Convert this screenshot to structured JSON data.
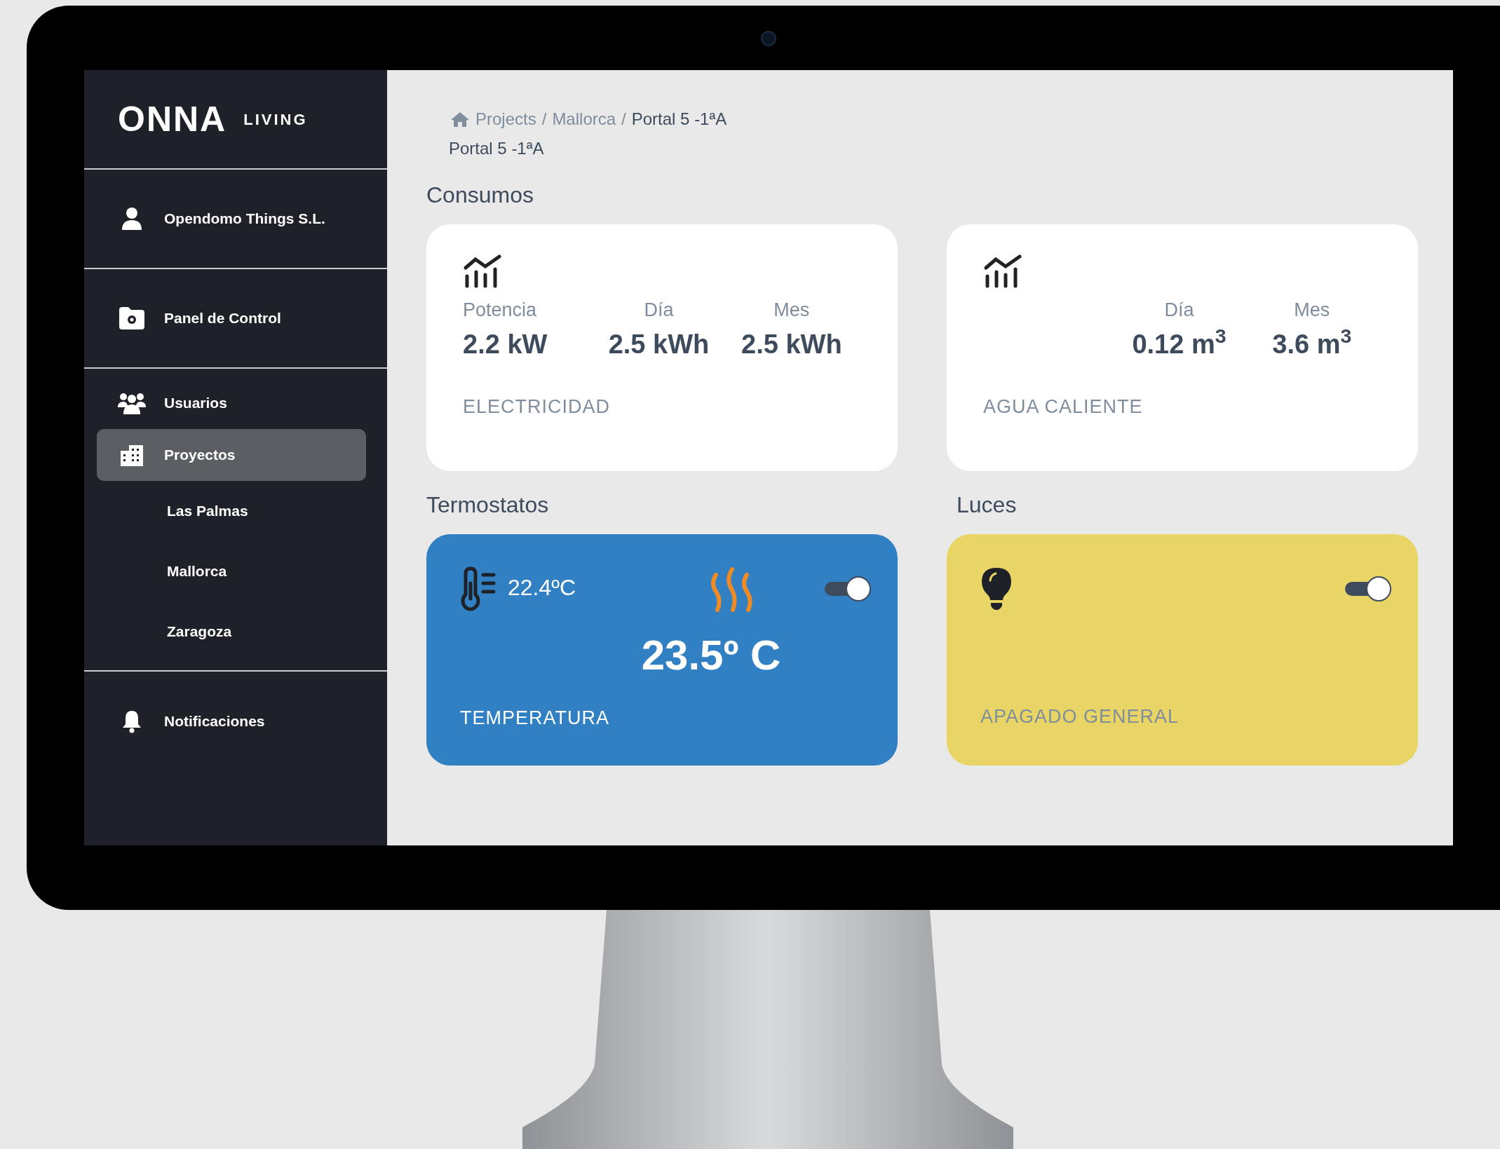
{
  "sidebar": {
    "logo": {
      "brand": "ONNA",
      "tagline": "LIVING"
    },
    "groups": [
      {
        "items": [
          {
            "kind": "nav",
            "label": "Opendomo Things S.L.",
            "selected": false
          }
        ]
      },
      {
        "items": [
          {
            "kind": "nav",
            "label": "Panel de Control",
            "selected": false
          }
        ]
      },
      {
        "items": [
          {
            "kind": "nav",
            "label": "Usuarios",
            "selected": false
          },
          {
            "kind": "nav",
            "label": "Proyectos",
            "selected": true
          },
          {
            "kind": "sub",
            "label": "Las Palmas",
            "selected": false
          },
          {
            "kind": "sub",
            "label": "Mallorca",
            "selected": false
          },
          {
            "kind": "sub",
            "label": "Zaragoza",
            "selected": false
          }
        ]
      },
      {
        "items": [
          {
            "kind": "nav",
            "label": "Notificaciones",
            "selected": false
          }
        ]
      }
    ]
  },
  "breadcrumb": [
    {
      "kind": "link",
      "label": "Projects"
    },
    {
      "kind": "separator",
      "label": "/"
    },
    {
      "kind": "link",
      "label": "Mallorca"
    },
    {
      "kind": "separator",
      "label": "/"
    },
    {
      "kind": "current",
      "label": "Portal 5 -1ªA"
    }
  ],
  "page_title": "Portal 5 -1ªA",
  "consumos": {
    "title": "Consumos",
    "cards": [
      {
        "label": "ELECTRICIDAD",
        "metrics": [
          {
            "name": "Potencia",
            "value": "2.2 kW"
          },
          {
            "name": "Día",
            "value": "2.5 kWh"
          },
          {
            "name": "Mes",
            "value": "2.5 kWh"
          }
        ]
      },
      {
        "label": "AGUA CALIENTE",
        "metrics": [
          {
            "name": "Día",
            "value": "0.12 m$^{3}$"
          },
          {
            "name": "Mes",
            "value": "3.6 m$^{3}$"
          }
        ]
      }
    ]
  },
  "termostatos": {
    "title": "Termostatos",
    "current": "22.4ºC",
    "setpoint": "23.5º C",
    "label": "TEMPERATURA",
    "heating": true,
    "on": true
  },
  "luces": {
    "title": "Luces",
    "label": "APAGADO GENERAL",
    "on": true
  }
}
